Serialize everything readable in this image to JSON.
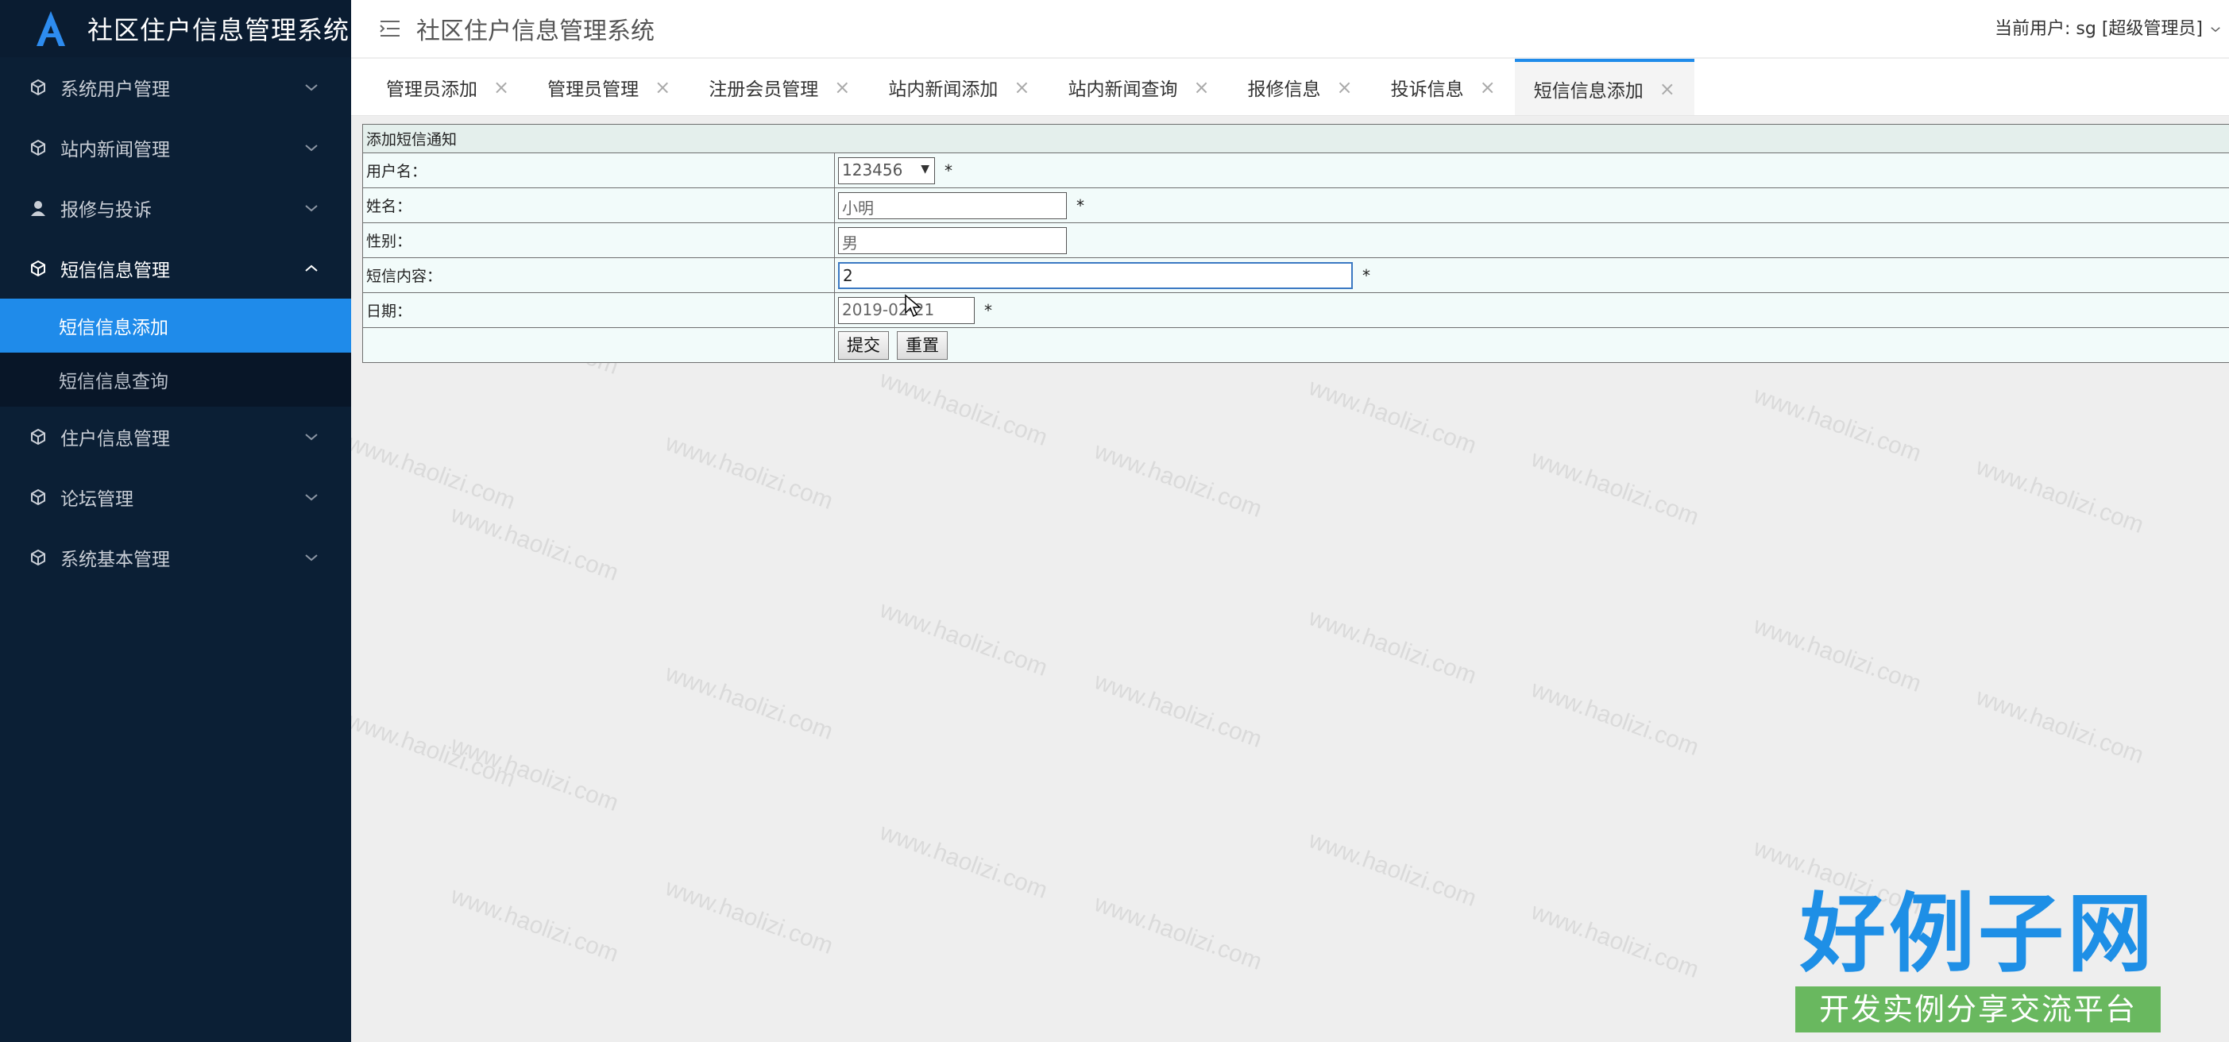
{
  "sidebar": {
    "brand_title": "社区住户信息管理系统",
    "menu": [
      {
        "label": "系统用户管理",
        "icon": "cube-icon"
      },
      {
        "label": "站内新闻管理",
        "icon": "cube-icon"
      },
      {
        "label": "报修与投诉",
        "icon": "user-icon"
      },
      {
        "label": "短信信息管理",
        "icon": "cube-icon",
        "open": true
      },
      {
        "label": "住户信息管理",
        "icon": "cube-icon"
      },
      {
        "label": "论坛管理",
        "icon": "cube-icon"
      },
      {
        "label": "系统基本管理",
        "icon": "cube-icon"
      }
    ],
    "submenu": [
      {
        "label": "短信信息添加",
        "active": true
      },
      {
        "label": "短信信息查询"
      }
    ]
  },
  "header": {
    "title": "社区住户信息管理系统",
    "user_info": "当前用户:  sg [超级管理员]"
  },
  "tabs": [
    {
      "label": "管理员添加"
    },
    {
      "label": "管理员管理"
    },
    {
      "label": "注册会员管理"
    },
    {
      "label": "站内新闻添加"
    },
    {
      "label": "站内新闻查询"
    },
    {
      "label": "报修信息"
    },
    {
      "label": "投诉信息"
    },
    {
      "label": "短信信息添加",
      "active": true
    }
  ],
  "tab_close_glyph": "×",
  "form": {
    "heading": "添加短信通知",
    "username_label": "用户名：",
    "username_value": "123456",
    "name_label": "姓名：",
    "name_value": "小明",
    "sex_label": "性别：",
    "sex_value": "男",
    "content_label": "短信内容：",
    "content_value": "2",
    "date_label": "日期：",
    "date_value": "2019-02-21",
    "required_mark": "*",
    "submit_label": "提交",
    "reset_label": "重置"
  },
  "watermark": "www.haolizi.com",
  "corner_logo": {
    "title": "好例子网",
    "slogan": "开发实例分享交流平台"
  },
  "colors": {
    "sidebar_bg": "#0b1f35",
    "accent": "#1f8bea",
    "logo_green": "#69b85f"
  }
}
